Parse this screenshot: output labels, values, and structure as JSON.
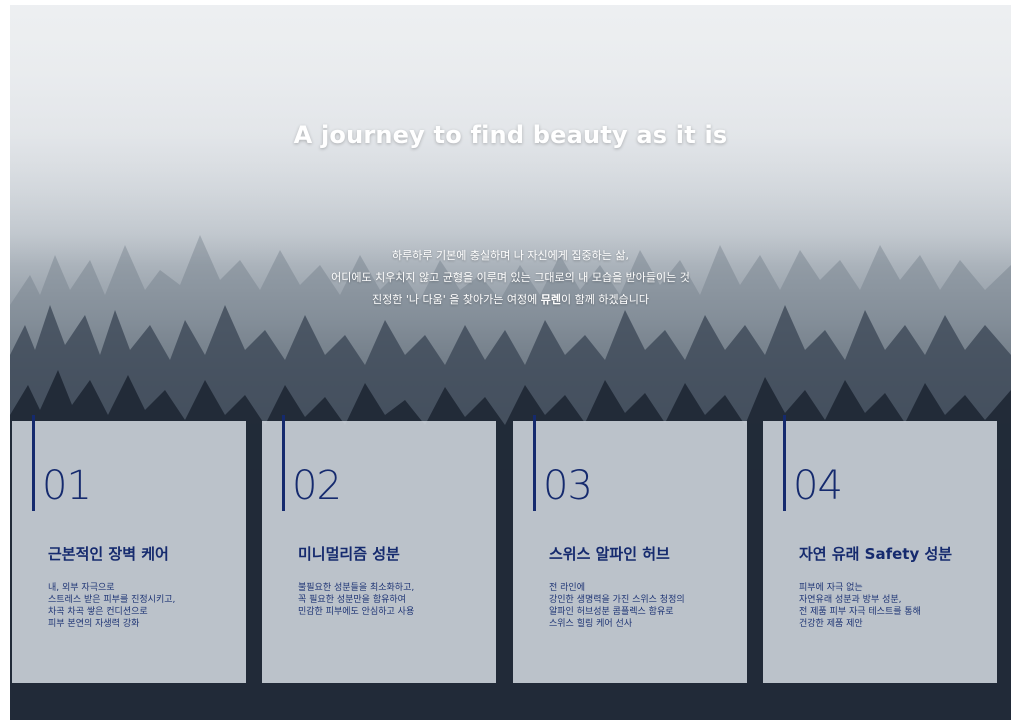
{
  "hero": {
    "title": "A journey to find beauty as it is",
    "lines": [
      "하루하루 기본에 충실하며 나 자신에게 집중하는 삶,",
      "어디에도 치우치지 않고 균형을 이루며 있는 그대로의 내 모습을 받아들이는 것"
    ],
    "line3_before": "진정한 '나 다움' 을 찾아가는 여정에 ",
    "brand": "뮤렌",
    "line3_after": "이 함께 하겠습니다"
  },
  "cards": [
    {
      "number": "01",
      "title": "근본적인 장벽 케어",
      "desc": "내, 외부 자극으로\n스트레스 받은 피부를 진정시키고,\n차곡 차곡 쌓은 컨디션으로\n피부 본연의 자생력 강화"
    },
    {
      "number": "02",
      "title": "미니멀리즘 성분",
      "desc": "불필요한 성분들을 최소화하고,\n꼭 필요한 성분만을 함유하여\n민감한 피부에도 안심하고 사용"
    },
    {
      "number": "03",
      "title": "스위스 알파인 허브",
      "desc": "전 라인에\n강인한 생명력을 가진 스위스 청정의\n알파인 허브성분 콤플렉스 함유로\n스위스 힐링 케어 선사"
    },
    {
      "number": "04",
      "title": "자연 유래 Safety 성분",
      "desc": "피부에 자극 없는\n자연유래 성분과 방부 성분,\n전 제품 피부 자극 테스트를 통해\n건강한 제품 제안"
    }
  ],
  "colors": {
    "accent": "#152a6e",
    "card_bg": "#d5dbe2",
    "text_light": "#ffffff"
  }
}
